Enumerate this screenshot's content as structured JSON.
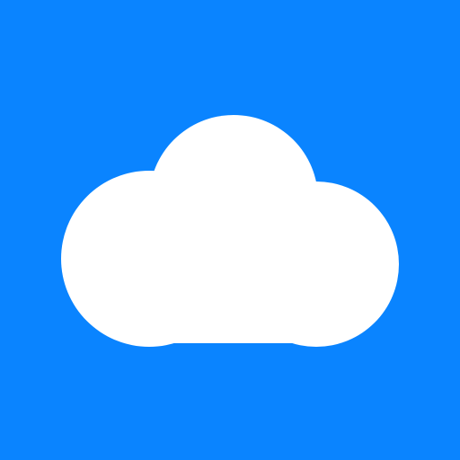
{
  "app_icon": {
    "icon": "cloud-icon",
    "background_color": "#0a84ff",
    "cloud_color": "#ffffff"
  }
}
